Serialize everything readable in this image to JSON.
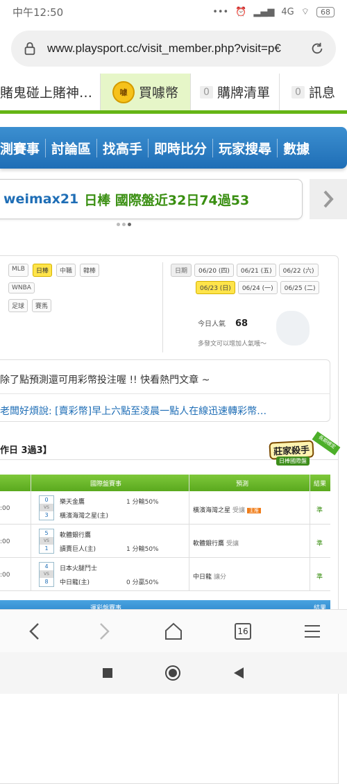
{
  "status": {
    "time": "中午12:50",
    "network": "4G",
    "battery": "68"
  },
  "browser": {
    "url": "www.playsport.cc/visit_member.php?visit=p€",
    "tab_count": "16"
  },
  "top_tabs": [
    {
      "label": "賭鬼碰上賭神…"
    },
    {
      "label": "買噱幣",
      "coin": "噱"
    },
    {
      "label": "購牌清單",
      "count": "0"
    },
    {
      "label": "訊息",
      "count": "0"
    }
  ],
  "nav": [
    "測賽事",
    "討論區",
    "找高手",
    "即時比分",
    "玩家搜尋",
    "數據"
  ],
  "ticker": {
    "user": "weimax21",
    "text": "日棒 國際盤近32日74過53"
  },
  "filters": {
    "row1": [
      "MLB",
      "日棒",
      "中職",
      "韓棒"
    ],
    "row2": [
      "WNBA"
    ],
    "row3": [
      "足球",
      "賽馬"
    ],
    "active": "日棒"
  },
  "dates": {
    "label": "日期",
    "row1": [
      "06/20 (四)",
      "06/21 (五)",
      "06/22 (六)"
    ],
    "row2": [
      "06/23 (日)",
      "06/24 (一)",
      "06/25 (二)"
    ],
    "active": "06/23 (日)"
  },
  "popularity": {
    "label": "今日人氣",
    "value": "68",
    "hint": "多發文可以增加人氣哦～"
  },
  "messages": {
    "line1": "除了點預測還可用彩幣投注喔 !! 快看熱門文章 ~",
    "line2": "老闆好煩說: [賣彩幣]早上六點至凌晨一點人在線迅速轉彩幣…"
  },
  "stats": {
    "title": "作日 3過3】"
  },
  "badge": {
    "title": "莊家殺手",
    "sub": "日棒國際盤",
    "ribbon": "長期穩定"
  },
  "table": {
    "headers": {
      "event": "國際盤賽事",
      "pick": "預測",
      "result": "結果"
    },
    "rows": [
      {
        "time": ":00",
        "s1": "0",
        "s2": "3",
        "t1": "樂天金鷹",
        "t2": "橫濱海灣之星(主)",
        "line": "1 分輸50%",
        "line_pos": "top",
        "pick": "橫濱海灣之星",
        "pick_sub": "受讓",
        "tag": "主推",
        "result": "準"
      },
      {
        "time": ":00",
        "s1": "5",
        "s2": "1",
        "t1": "軟體銀行鷹",
        "t2": "讀賣巨人(主)",
        "line": "1 分輸50%",
        "line_pos": "bottom",
        "pick": "軟體銀行鷹",
        "pick_sub": "受讓",
        "tag": "",
        "result": "準"
      },
      {
        "time": ":00",
        "s1": "4",
        "s2": "8",
        "t1": "日本火腿鬥士",
        "t2": "中日龍(主)",
        "line": "0 分贏50%",
        "line_pos": "bottom",
        "pick": "中日龍",
        "pick_sub": "讓分",
        "tag": "",
        "result": "準"
      }
    ],
    "headers2": {
      "event": "運彩盤賽事",
      "result": "結果"
    },
    "vs": "VS"
  },
  "colors": {
    "green": "#65b515",
    "blue": "#1f6eb6",
    "yellow": "#ffe44a"
  }
}
